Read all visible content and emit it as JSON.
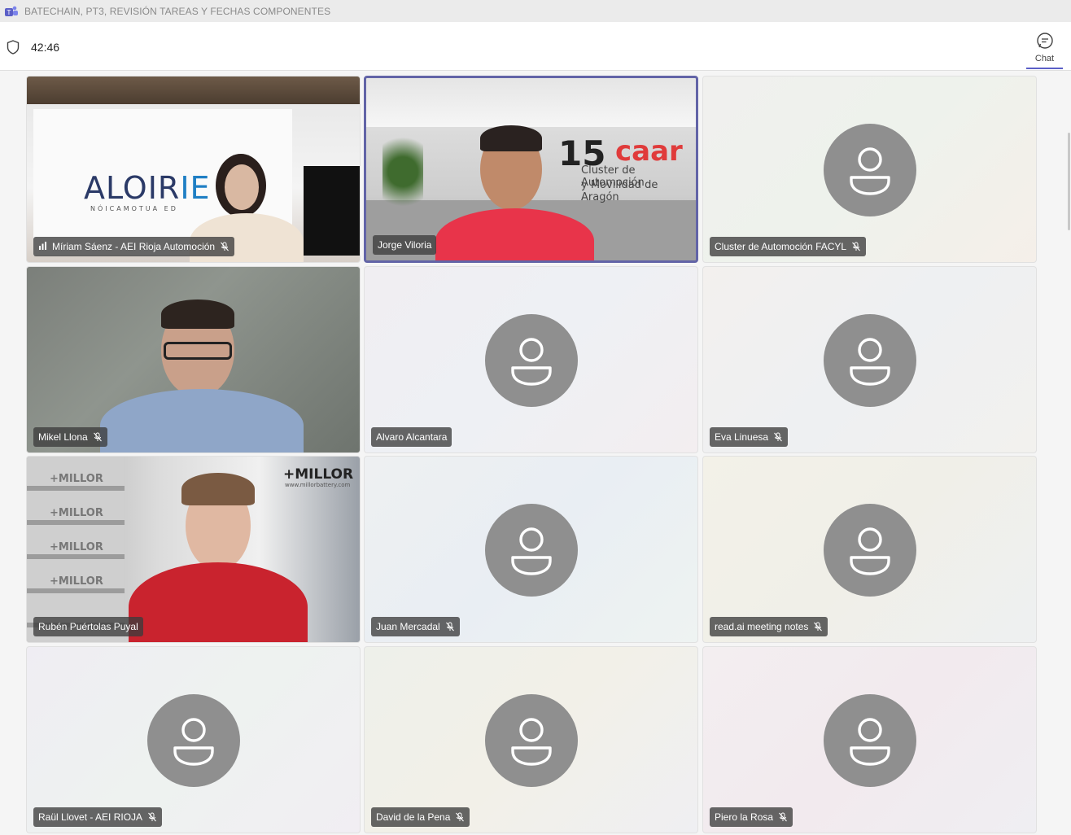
{
  "window": {
    "title": "BATECHAIN, PT3, REVISIÓN TAREAS Y FECHAS COMPONENTES"
  },
  "meeting": {
    "timer": "42:46"
  },
  "header": {
    "chat_label": "Chat"
  },
  "participants": [
    {
      "name": "Míriam Sáenz - AEI Rioja Automoción",
      "video": true
    },
    {
      "name": "Jorge Viloria",
      "video": true,
      "speaking": true
    },
    {
      "name": "Cluster de Automoción FACYL",
      "video": false
    },
    {
      "name": "Mikel Llona",
      "video": true
    },
    {
      "name": "Alvaro Alcantara",
      "video": false
    },
    {
      "name": "Eva Linuesa",
      "video": false
    },
    {
      "name": "Rubén Puértolas Puyal",
      "video": true
    },
    {
      "name": "Juan Mercadal",
      "video": false
    },
    {
      "name": "read.ai meeting notes",
      "video": false
    },
    {
      "name": "Raül Llovet - AEI RIOJA",
      "video": false
    },
    {
      "name": "David de la Pena",
      "video": false
    },
    {
      "name": "Piero la Rosa",
      "video": false
    }
  ],
  "video_text": {
    "rioja_logo": "ALOIR",
    "rioja_logo_accent": "IE",
    "rioja_sub": "NÓICAMOTUA ED",
    "caar_number": "15",
    "caar_brand": "caar",
    "caar_line1": "Cluster de Automoción",
    "caar_line2": "y Movilidad de Aragón",
    "millor_brand": "+MILLOR",
    "millor_url": "www.millorbattery.com",
    "millor_box": "+MILLOR"
  },
  "colors": {
    "accent": "#5b5fc7",
    "speaking_border": "#6264a7",
    "avatar": "#8f8f8f"
  }
}
